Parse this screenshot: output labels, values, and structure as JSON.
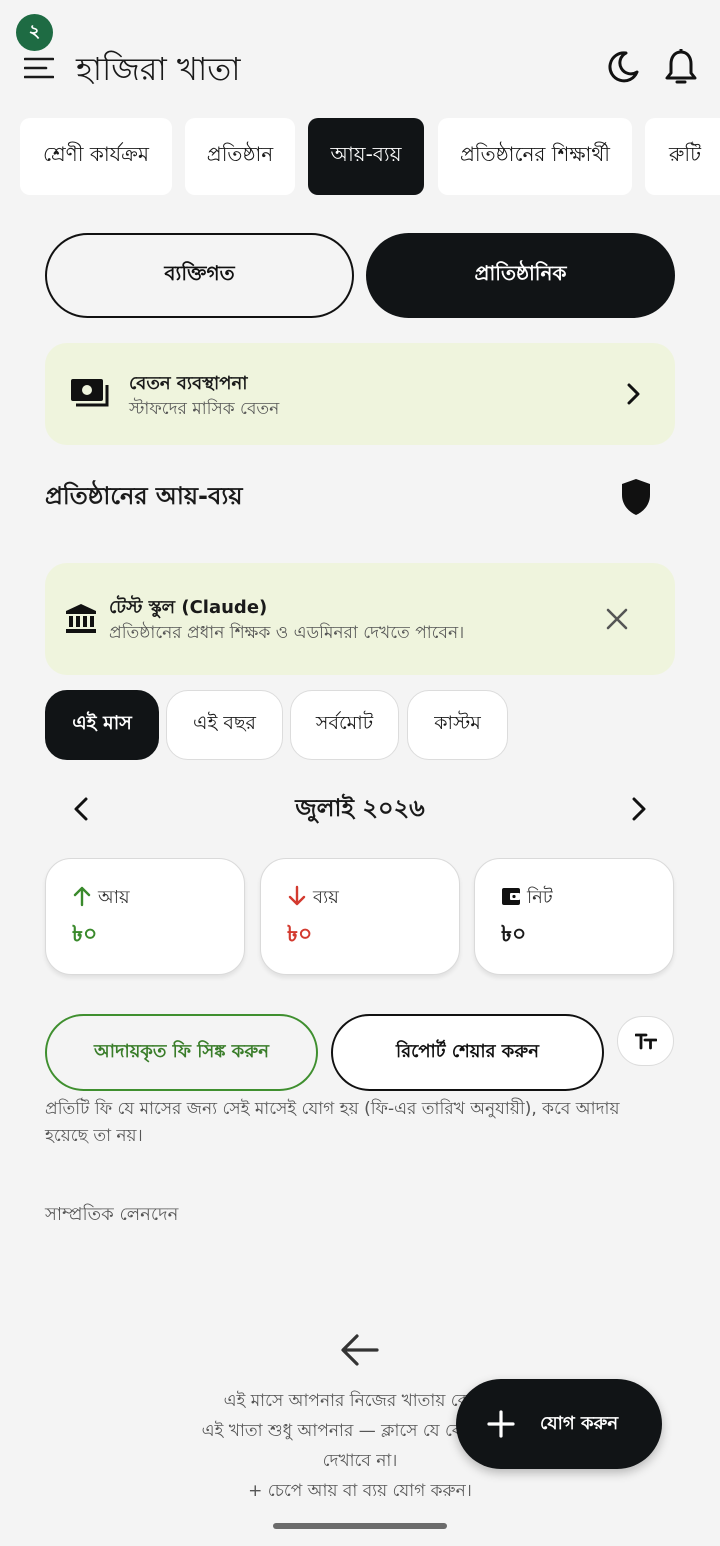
{
  "header": {
    "notification_count": "২",
    "title": "হাজিরা খাতা"
  },
  "tabs": [
    {
      "label": "শ্রেণী কার্যক্রম",
      "active": false
    },
    {
      "label": "প্রতিষ্ঠান",
      "active": false
    },
    {
      "label": "আয়-ব্যয়",
      "active": true
    },
    {
      "label": "প্রতিষ্ঠানের শিক্ষার্থী",
      "active": false
    },
    {
      "label": "রুটি",
      "active": false
    }
  ],
  "segment": {
    "personal": "ব্যক্তিগত",
    "institutional": "প্রাতিষ্ঠানিক"
  },
  "salary_card": {
    "title": "বেতন ব্যবস্থাপনা",
    "subtitle": "স্টাফদের মাসিক বেতন"
  },
  "section_title": "প্রতিষ্ঠানের আয়-ব্যয়",
  "school_card": {
    "title": "টেস্ট স্কুল (Claude)",
    "subtitle": "প্রতিষ্ঠানের প্রধান শিক্ষক ও এডমিনরা দেখতে পাবেন।"
  },
  "periods": [
    {
      "label": "এই মাস",
      "active": true
    },
    {
      "label": "এই বছর",
      "active": false
    },
    {
      "label": "সর্বমোট",
      "active": false
    },
    {
      "label": "কাস্টম",
      "active": false
    }
  ],
  "month_label": "জুলাই ২০২৬",
  "stats": {
    "income": {
      "label": "আয়",
      "value": "৳০",
      "color": "#3a8a2c"
    },
    "expense": {
      "label": "ব্যয়",
      "value": "৳০",
      "color": "#d33a2f"
    },
    "net": {
      "label": "নিট",
      "value": "৳০",
      "color": "#1a1a1a"
    }
  },
  "actions": {
    "sync": "আদায়কৃত ফি সিঙ্ক করুন",
    "share": "রিপোর্ট শেয়ার করুন"
  },
  "note": "প্রতিটি ফি যে মাসের জন্য সেই মাসেই যোগ হয় (ফি-এর তারিখ অনুযায়ী), কবে আদায় হয়েছে তা নয়।",
  "recent_label": "সাম্প্রতিক লেনদেন",
  "empty_state": {
    "line1": "এই মাসে আপনার নিজের খাতায় কোনো",
    "line2": "এই খাতা শুধু আপনার — ক্লাসে যে বেতন আদ",
    "line3": "দেখাবে না।",
    "line4": "+ চেপে আয় বা ব্যয় যোগ করুন।"
  },
  "fab_label": "যোগ করুন"
}
